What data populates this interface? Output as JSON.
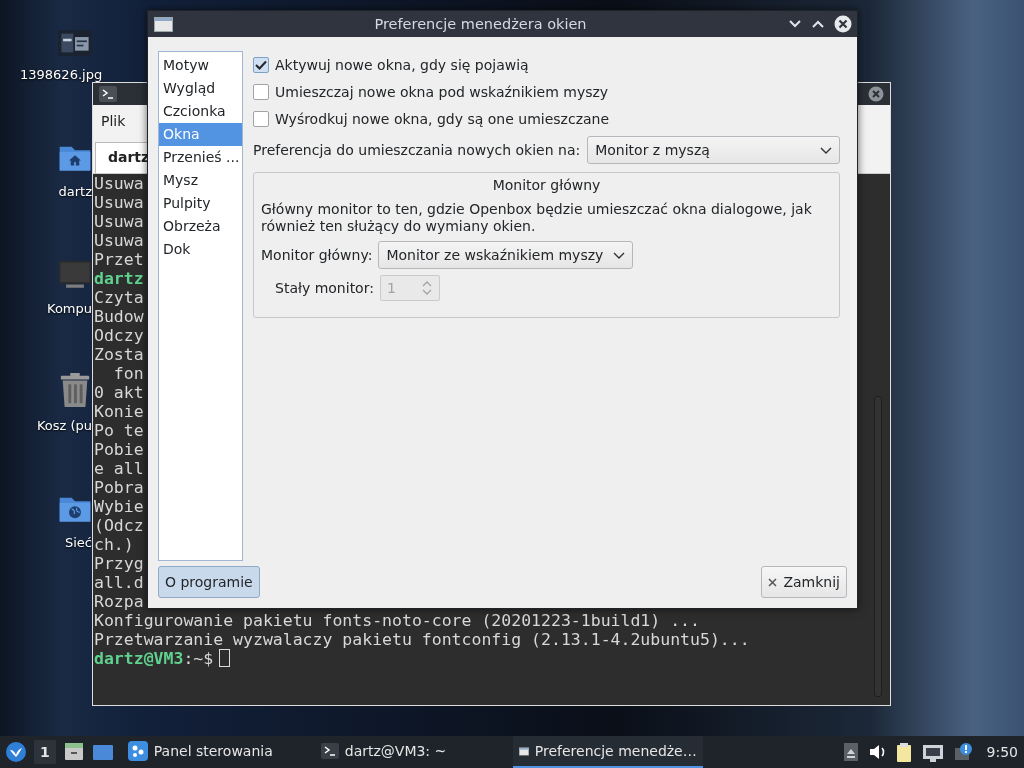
{
  "desktop": {
    "icons": [
      {
        "label": "1398626.jpg"
      },
      {
        "label": "dartz",
        "kind": "home"
      },
      {
        "label": "Kompu",
        "kind": "computer"
      },
      {
        "label": "Kosz (pu",
        "kind": "trash"
      },
      {
        "label": "Sieć",
        "kind": "network"
      }
    ]
  },
  "terminal": {
    "menu": [
      "Plik"
    ],
    "tab": "dartz",
    "lines": [
      {
        "kind": "output",
        "text": "Usuwa"
      },
      {
        "kind": "output",
        "text": "Usuwa"
      },
      {
        "kind": "output",
        "text": "Usuwa"
      },
      {
        "kind": "output",
        "text": "Usuwa"
      },
      {
        "kind": "output",
        "text": "Przet"
      },
      {
        "kind": "prompt",
        "user": "dartz"
      },
      {
        "kind": "output",
        "text": "Czyta"
      },
      {
        "kind": "output",
        "text": "Budow"
      },
      {
        "kind": "output",
        "text": "Odczy"
      },
      {
        "kind": "output",
        "text": "Zosta"
      },
      {
        "kind": "output",
        "text": "  fon"
      },
      {
        "kind": "output",
        "text": "0 akt"
      },
      {
        "kind": "output",
        "text": "Konie"
      },
      {
        "kind": "output",
        "text": "Po te"
      },
      {
        "kind": "output",
        "text": "Pobie"
      },
      {
        "kind": "output",
        "text": "e all"
      },
      {
        "kind": "output",
        "text": "Pobra"
      },
      {
        "kind": "output",
        "text": "Wybie"
      },
      {
        "kind": "output",
        "text": "(Odcz"
      },
      {
        "kind": "output",
        "text": "ch.)"
      },
      {
        "kind": "output",
        "text": "Przyg"
      },
      {
        "kind": "output",
        "text": "all.d"
      },
      {
        "kind": "output",
        "text": "Rozpa"
      },
      {
        "kind": "output",
        "text": "Konfigurowanie pakietu fonts-noto-core (20201223-1build1) ..."
      },
      {
        "kind": "output",
        "text": "Przetwarzanie wyzwalaczy pakietu fontconfig (2.13.1-4.2ubuntu5)..."
      },
      {
        "kind": "prompt",
        "user": "dartz@VM3",
        "path": ":~$",
        "cursor": true
      }
    ]
  },
  "dialog": {
    "title": "Preferencje menedżera okien",
    "sidebar": [
      {
        "label": "Motyw",
        "selected": false
      },
      {
        "label": "Wygląd",
        "selected": false
      },
      {
        "label": "Czcionka",
        "selected": false
      },
      {
        "label": "Okna",
        "selected": true
      },
      {
        "label": "Przenieś ...",
        "selected": false
      },
      {
        "label": "Mysz",
        "selected": false
      },
      {
        "label": "Pulpity",
        "selected": false
      },
      {
        "label": "Obrzeża",
        "selected": false
      },
      {
        "label": "Dok",
        "selected": false
      }
    ],
    "options": [
      {
        "label": "Aktywuj nowe okna, gdy się pojawią",
        "checked": true
      },
      {
        "label": "Umieszczaj nowe okna pod wskaźnikiem myszy",
        "checked": false
      },
      {
        "label": "Wyśrodkuj nowe okna, gdy są one umieszczane",
        "checked": false
      }
    ],
    "placement": {
      "label": "Preferencja do umieszczania nowych okien na:",
      "value": "Monitor z myszą"
    },
    "primary_monitor": {
      "title": "Monitor główny",
      "description": "Główny monitor to ten, gdzie Openbox będzie umieszczać okna dialogowe, jak również ten służący do wymiany okien.",
      "monitor_label": "Monitor główny:",
      "monitor_value": "Monitor ze wskaźnikiem myszy",
      "fixed_label": "Stały monitor:",
      "fixed_value": "1",
      "fixed_disabled": true
    },
    "buttons": [
      {
        "label": "O programie",
        "kind": "about",
        "focused": true
      },
      {
        "label": "Zamknij",
        "kind": "close",
        "focused": false
      }
    ]
  },
  "taskbar": {
    "workspace": "1",
    "tasks": [
      {
        "label": "Panel sterowania",
        "kind": "control-panel",
        "selected": false
      },
      {
        "label": "dartz@VM3: ~",
        "kind": "terminal",
        "selected": false
      },
      {
        "label": "Preferencje menedże…",
        "kind": "window",
        "selected": true
      }
    ],
    "clock": "9:50"
  }
}
